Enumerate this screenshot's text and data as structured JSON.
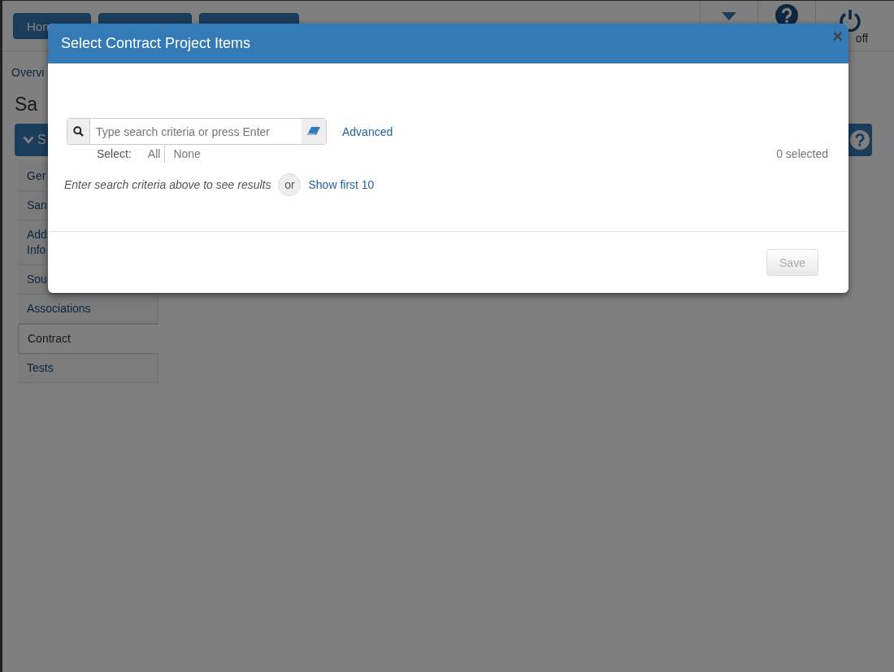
{
  "page": {
    "nav_button_label": "Hom",
    "power_label": "off",
    "breadcrumb": "Overvi",
    "heading": "Sa",
    "section_label": "S",
    "sidebar": [
      {
        "label": "Ger",
        "selected": false
      },
      {
        "label": "San",
        "selected": false
      },
      {
        "label": "Add\nInfo",
        "selected": false
      },
      {
        "label": "Sou",
        "selected": false
      },
      {
        "label": "Associations",
        "selected": false
      },
      {
        "label": "Contract",
        "selected": true
      },
      {
        "label": "Tests",
        "selected": false
      }
    ]
  },
  "dialog": {
    "title": "Select Contract Project Items",
    "close": "×",
    "search": {
      "placeholder": "Type search criteria or press Enter"
    },
    "advanced_link": "Advanced",
    "select_label": "Select:",
    "select_all": "All",
    "select_none": "None",
    "selected_count": "0 selected",
    "hint": "Enter search criteria above to see results",
    "or_label": "or",
    "show_first_link": "Show first 10",
    "save_button": {
      "label": "Save",
      "disabled": true
    }
  }
}
